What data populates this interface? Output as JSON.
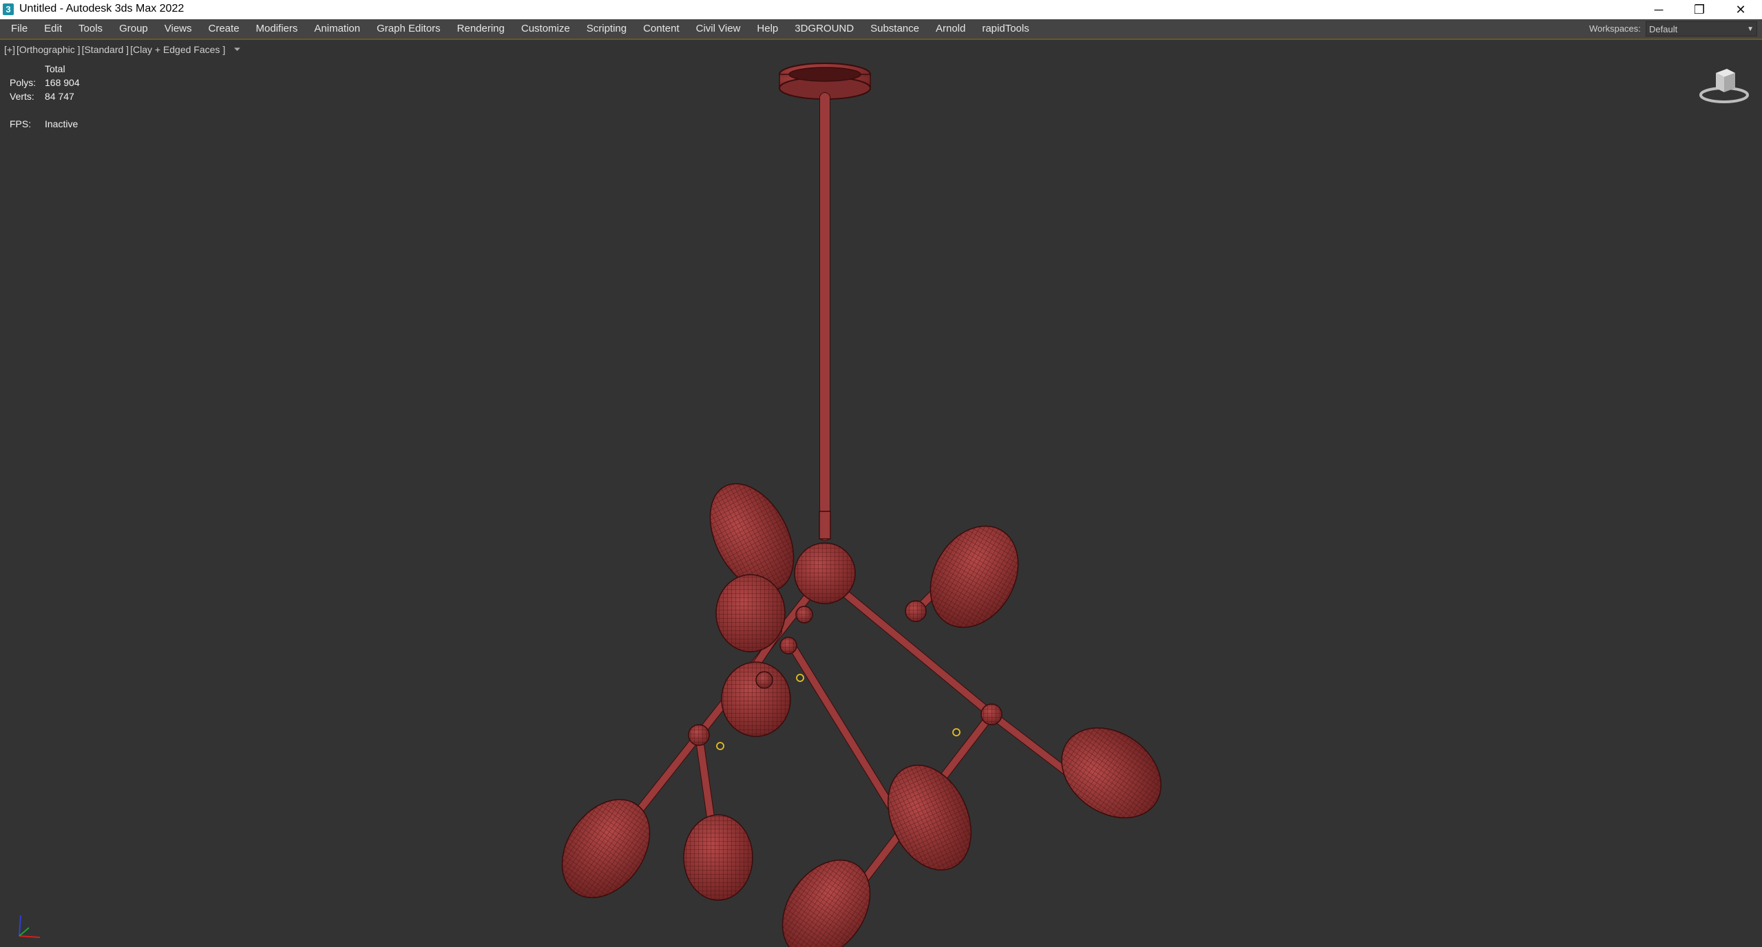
{
  "app": {
    "title": "Untitled - Autodesk 3ds Max 2022",
    "icon": "3ds-max-app-icon"
  },
  "window_controls": {
    "minimize": "─",
    "restore": "❐",
    "close": "✕"
  },
  "menu": [
    "File",
    "Edit",
    "Tools",
    "Group",
    "Views",
    "Create",
    "Modifiers",
    "Animation",
    "Graph Editors",
    "Rendering",
    "Customize",
    "Scripting",
    "Content",
    "Civil View",
    "Help",
    "3DGROUND",
    "Substance",
    "Arnold",
    "rapidTools"
  ],
  "workspaces": {
    "label": "Workspaces:",
    "value": "Default"
  },
  "viewport": {
    "label_parts": [
      "[+]",
      "[Orthographic ]",
      "[Standard ]",
      "[Clay + Edged Faces ]"
    ],
    "stats": {
      "header": "Total",
      "polys_label": "Polys:",
      "polys": "168 904",
      "verts_label": "Verts:",
      "verts": "84 747",
      "fps_label": "FPS:",
      "fps": "Inactive"
    },
    "model_color": "#9a3a3a",
    "wire_color": "#3a0c0c",
    "pivot_color": "#e6c020",
    "background": "#333333"
  },
  "colors": {
    "menubar_bg": "#444444",
    "menubar_accent": "#6c5a1d",
    "titlebar_bg": "#ffffff"
  }
}
